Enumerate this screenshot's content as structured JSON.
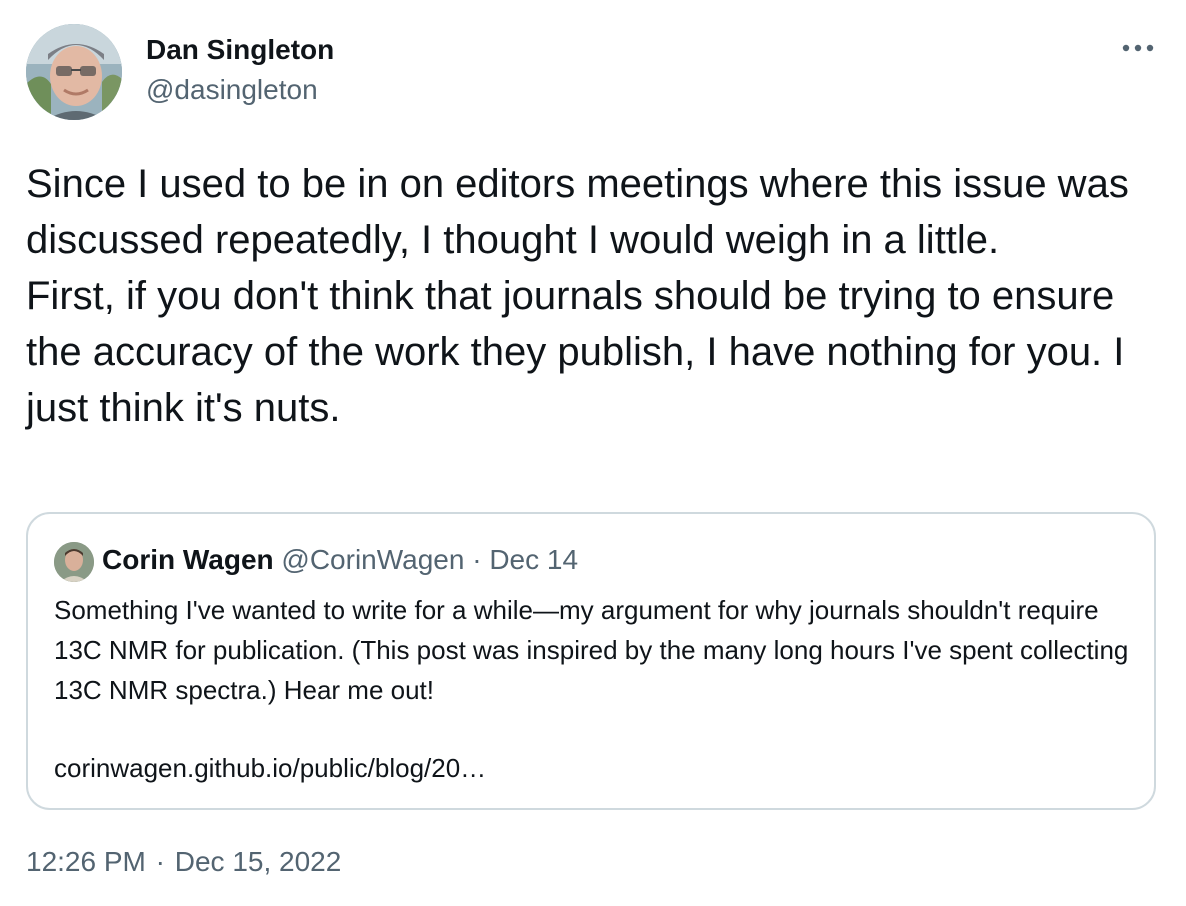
{
  "tweet": {
    "author": {
      "name": "Dan Singleton",
      "handle": "@dasingleton",
      "avatar_icon": "user-avatar-photo"
    },
    "more_icon": "more-horizontal-icon",
    "text_lines": [
      "Since I used to be in on editors meetings where this issue was discussed repeatedly, I thought I would weigh in a little.",
      "First, if you don't think that journals should be trying to ensure the accuracy of the work they publish, I have nothing for you. I just think it's nuts."
    ],
    "quoted": {
      "name": "Corin Wagen",
      "handle": "@CorinWagen",
      "separator": "·",
      "date": "Dec 14",
      "text": "Something I've wanted to write for a while—my argument for why journals shouldn't require 13C NMR for publication. (This post was inspired by the many long hours I've spent collecting 13C NMR spectra.) Hear me out!",
      "link": "corinwagen.github.io/public/blog/20…"
    },
    "timestamp": {
      "time": "12:26 PM",
      "separator": "·",
      "date": "Dec 15, 2022"
    }
  },
  "colors": {
    "text_primary": "#0f1419",
    "text_secondary": "#536471",
    "border": "#cfd9de"
  }
}
